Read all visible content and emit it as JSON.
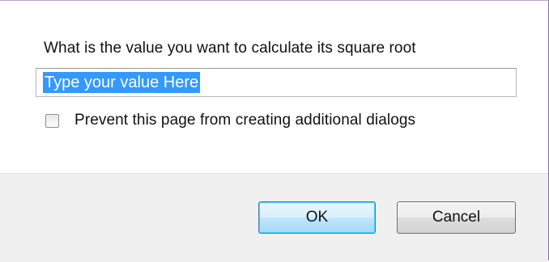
{
  "dialog": {
    "prompt": "What is the value you want to calculate its square root",
    "input": {
      "value": "Type your value Here",
      "selected": true
    },
    "checkbox": {
      "label": "Prevent this page from creating additional dialogs",
      "checked": false
    },
    "buttons": {
      "ok_label": "OK",
      "cancel_label": "Cancel"
    }
  },
  "colors": {
    "selection": "#3399ff",
    "button_area": "#f0f0f0",
    "default_button_border": "#3c7fb1"
  }
}
